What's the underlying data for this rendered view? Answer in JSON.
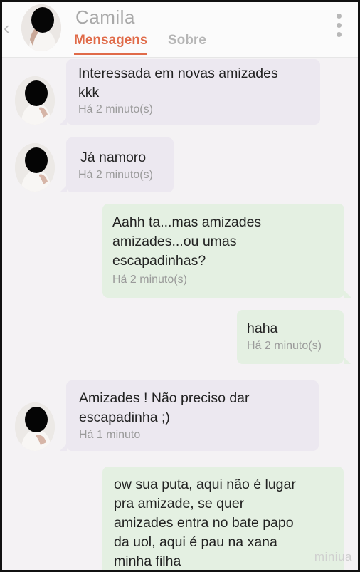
{
  "header": {
    "name": "Camila",
    "tabs": [
      {
        "label": "Mensagens",
        "active": true
      },
      {
        "label": "Sobre",
        "active": false
      }
    ]
  },
  "messages": [
    {
      "direction": "in",
      "text": "Interessada em novas amizades\nkkk",
      "time": "Há 2 minuto(s)"
    },
    {
      "direction": "in",
      "text": "Já namoro",
      "time": "Há 2 minuto(s)"
    },
    {
      "direction": "out",
      "text": "Aahh ta...mas amizades\namizades...ou umas\nescapadinhas?",
      "time": "Há 2 minuto(s)"
    },
    {
      "direction": "out",
      "text": "haha",
      "time": "Há 2 minuto(s)"
    },
    {
      "direction": "in",
      "text": "Amizades !  Não preciso dar\nescapadinha ;)",
      "time": "Há 1 minuto"
    },
    {
      "direction": "out",
      "text": "ow sua puta, aqui não é lugar\npra amizade, se quer\namizades entra no bate papo\nda uol, aqui é pau na xana\nminha filha",
      "time": ""
    }
  ],
  "watermark": "miniua",
  "colors": {
    "accent": "#e06b49",
    "incoming_bubble": "#ece8f0",
    "outgoing_bubble": "#e4f0e2"
  }
}
